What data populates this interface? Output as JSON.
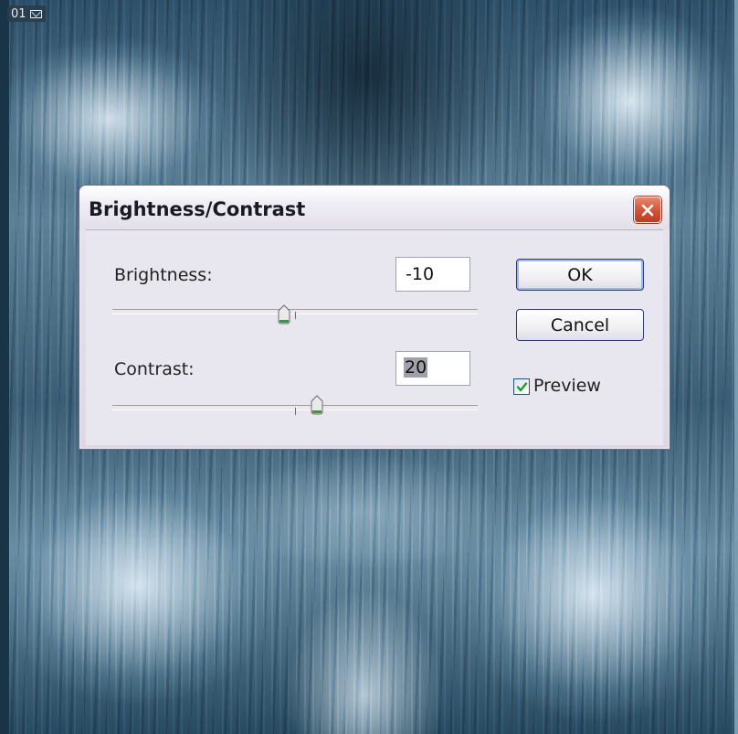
{
  "document": {
    "label": "01",
    "icon": "mail-icon"
  },
  "dialog": {
    "title": "Brightness/Contrast",
    "close_icon": "close-icon",
    "brightness": {
      "label": "Brightness:",
      "value": "-10",
      "level": -10,
      "range": [
        -100,
        100
      ]
    },
    "contrast": {
      "label": "Contrast:",
      "value": "20",
      "level": 20,
      "range": [
        -100,
        100
      ]
    },
    "ok_label": "OK",
    "cancel_label": "Cancel",
    "preview_label": "Preview",
    "preview_checked": true
  },
  "colors": {
    "close_button": "#d2563b",
    "button_border": "#2d3a78",
    "slider_thumb": "#2e9b3e"
  }
}
